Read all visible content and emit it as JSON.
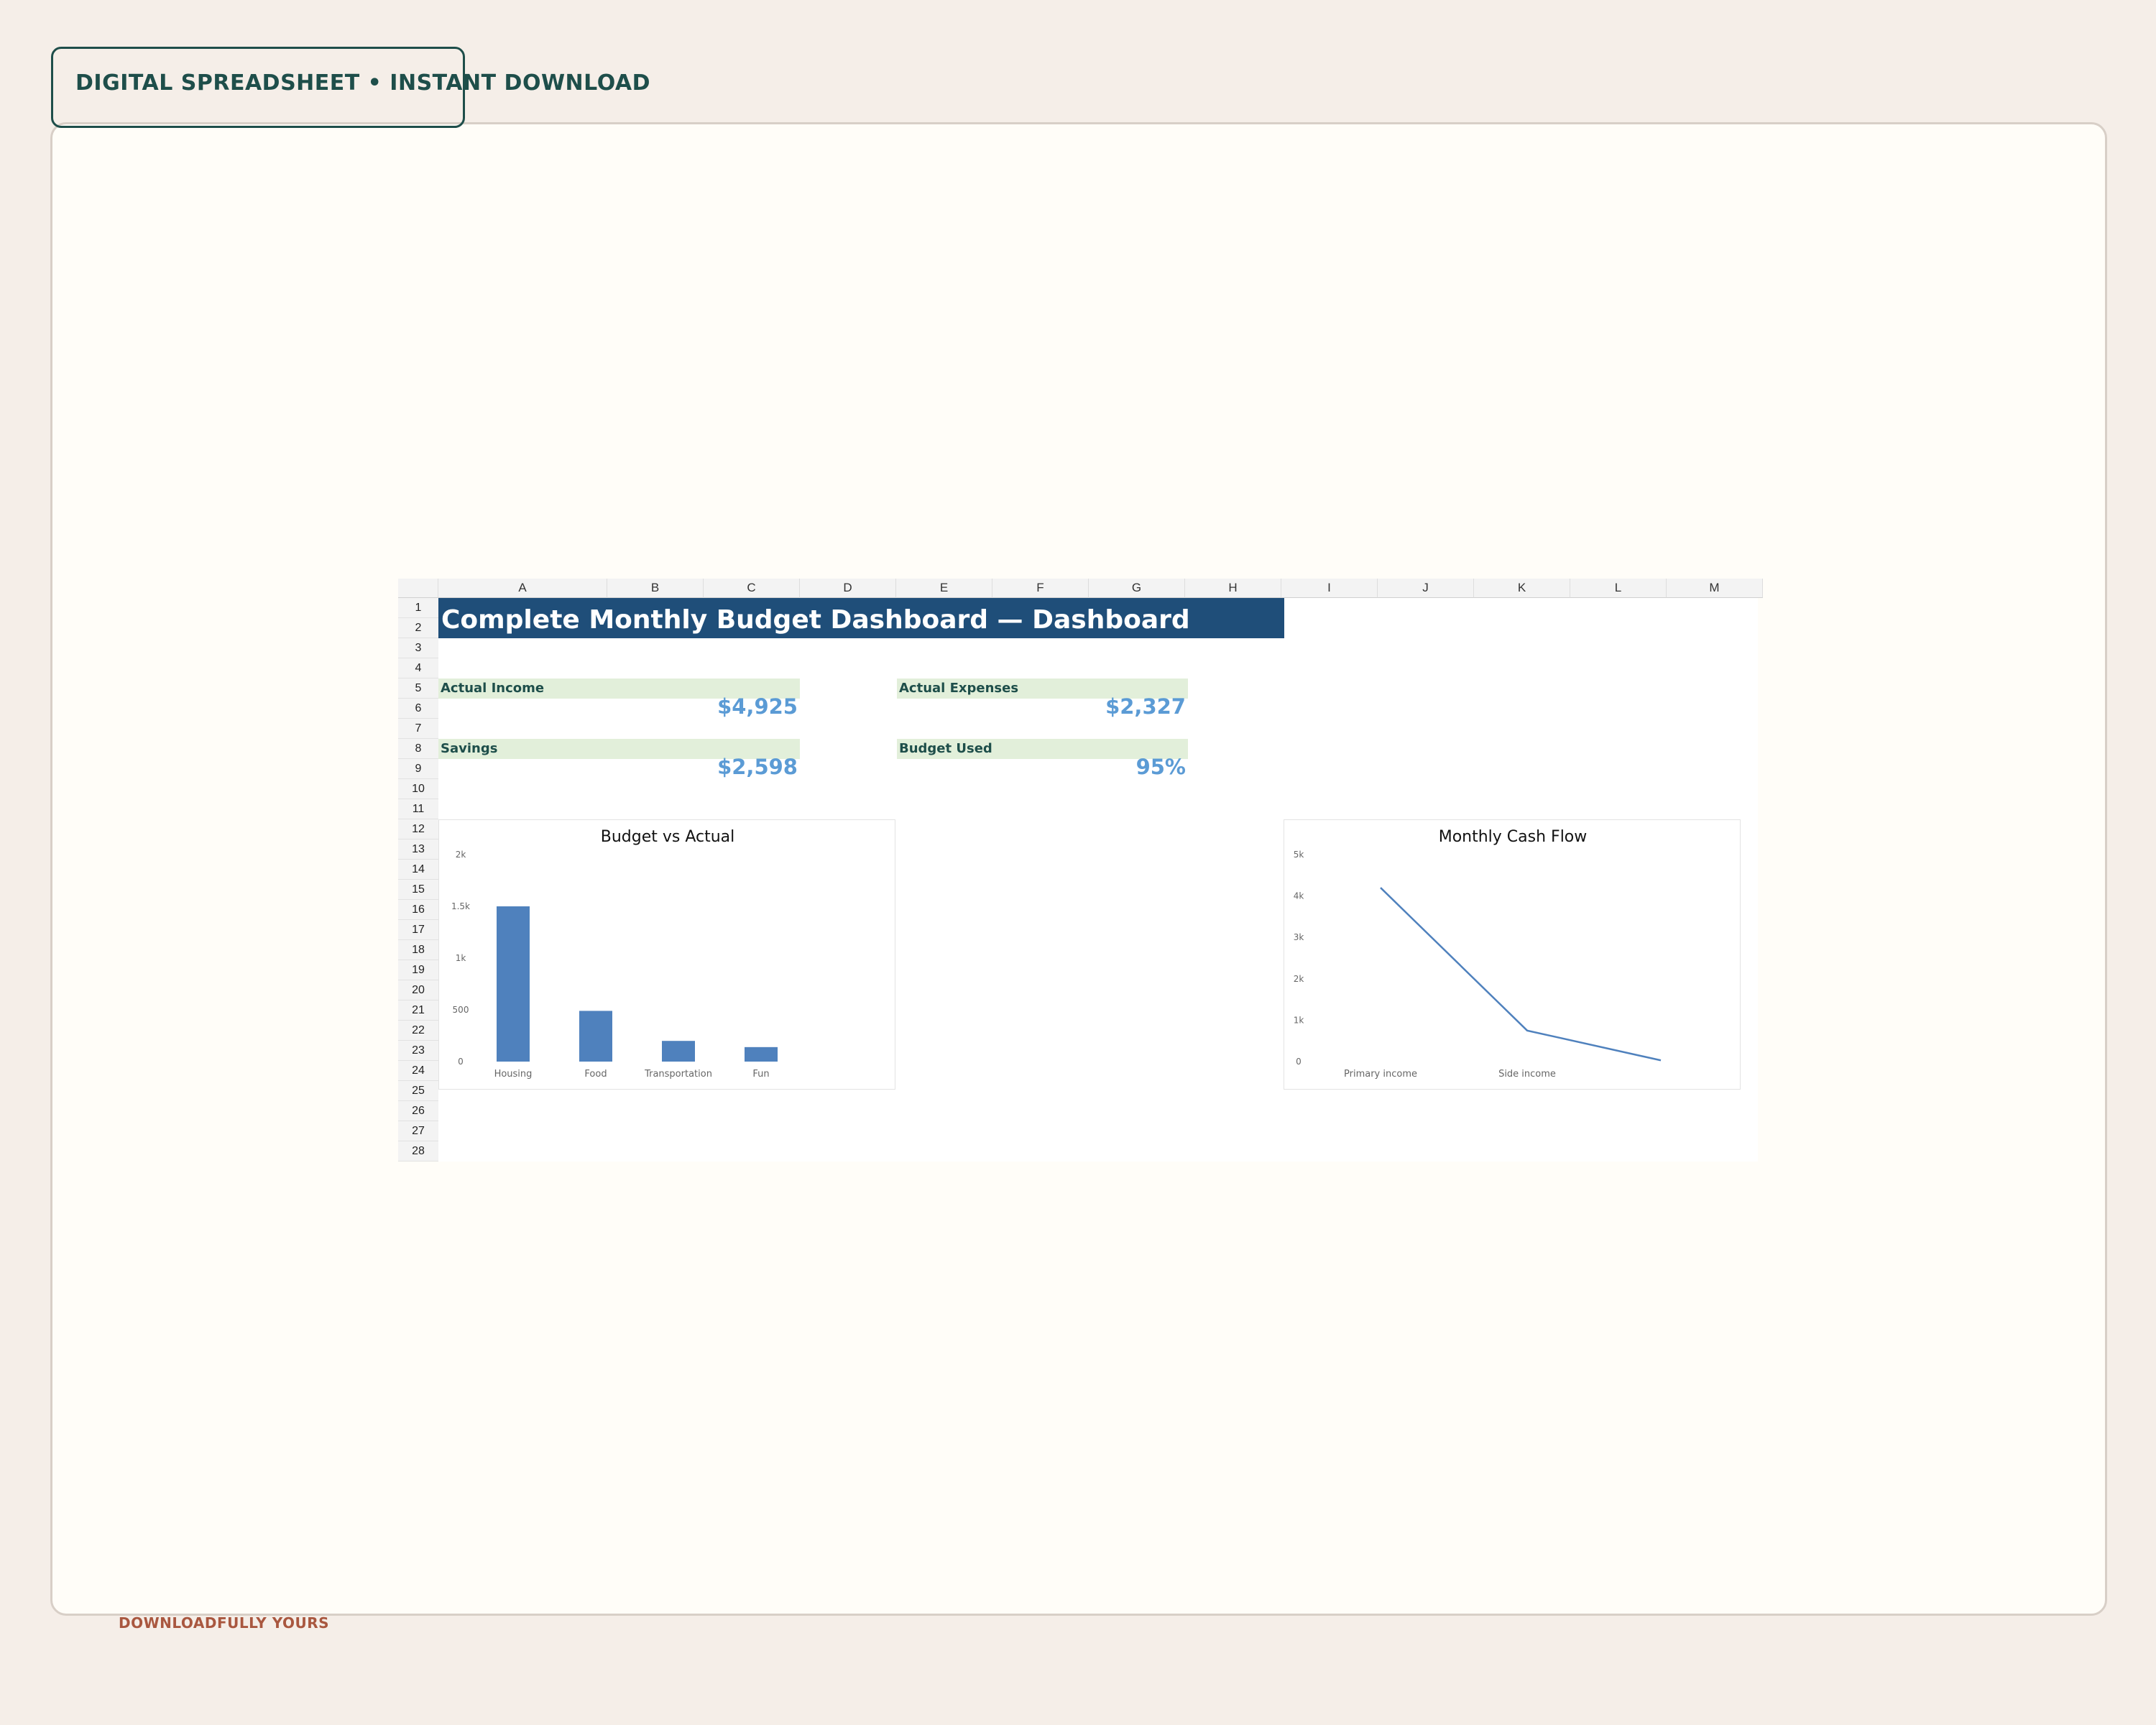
{
  "badge": {
    "label": "DIGITAL SPREADSHEET • INSTANT DOWNLOAD"
  },
  "footer": {
    "label": "DOWNLOADFULLY YOURS"
  },
  "sheet": {
    "columns": [
      "A",
      "B",
      "C",
      "D",
      "E",
      "F",
      "G",
      "H",
      "I",
      "J",
      "K",
      "L",
      "M"
    ],
    "rows": [
      "1",
      "2",
      "3",
      "4",
      "5",
      "6",
      "7",
      "8",
      "9",
      "10",
      "11",
      "12",
      "13",
      "14",
      "15",
      "16",
      "17",
      "18",
      "19",
      "20",
      "21",
      "22",
      "23",
      "24",
      "25",
      "26",
      "27",
      "28"
    ],
    "title": "Complete Monthly Budget Dashboard — Dashboard",
    "kpis": [
      {
        "label": "Actual Income",
        "value": "$4,925"
      },
      {
        "label": "Actual Expenses",
        "value": "$2,327"
      },
      {
        "label": "Savings",
        "value": "$2,598"
      },
      {
        "label": "Budget Used",
        "value": "95%"
      }
    ]
  },
  "colors": {
    "bar": "#4f81bd",
    "line": "#4f81bd",
    "title_fill": "#1f4e79",
    "kpi_fill": "#e2efda",
    "kpi_value": "#5b9bd5"
  },
  "chart_data": [
    {
      "type": "bar",
      "title": "Budget vs Actual",
      "categories": [
        "Housing",
        "Food",
        "Transportation",
        "Fun"
      ],
      "values": [
        1500,
        490,
        200,
        140
      ],
      "yticks": [
        "0",
        "500",
        "1k",
        "1.5k",
        "2k"
      ],
      "ylim": [
        0,
        2000
      ],
      "xlabel": "",
      "ylabel": ""
    },
    {
      "type": "line",
      "title": "Monthly Cash Flow",
      "categories": [
        "Primary income",
        "Side income",
        ""
      ],
      "values": [
        4200,
        750,
        30
      ],
      "yticks": [
        "0",
        "1k",
        "2k",
        "3k",
        "4k",
        "5k"
      ],
      "ylim": [
        0,
        5000
      ],
      "xlabel": "",
      "ylabel": ""
    }
  ]
}
